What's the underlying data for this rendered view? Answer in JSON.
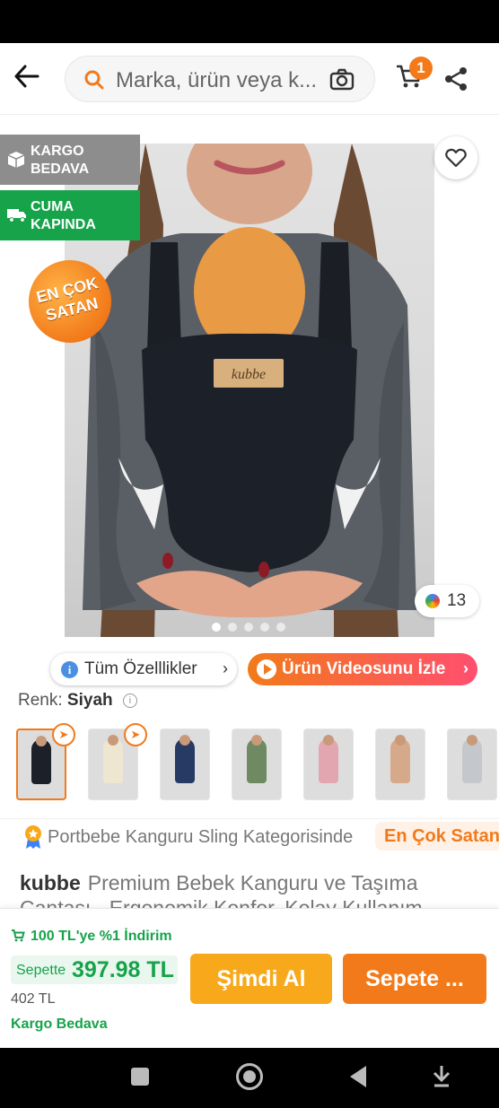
{
  "search": {
    "placeholder": "Marka, ürün veya k..."
  },
  "cart": {
    "count": "1"
  },
  "gallery": {
    "tags": [
      {
        "label": "KARGO BEDAVA"
      },
      {
        "label": "CUMA KAPINDA"
      }
    ],
    "best_seller_seal": "EN ÇOK SATAN",
    "product_logo": "kubbe",
    "color_count": "13",
    "image_count": 5,
    "active_image": 1
  },
  "features": {
    "all_features_label": "Tüm Özelllikler",
    "video_label": "Ürün Videosunu İzle"
  },
  "color": {
    "label": "Renk:",
    "value": "Siyah"
  },
  "variants": [
    {
      "name": "Siyah",
      "color": "#1c2028",
      "selected": true,
      "badge": true
    },
    {
      "name": "Krem",
      "color": "#efe6d2",
      "selected": false,
      "badge": true
    },
    {
      "name": "Lacivert",
      "color": "#263a64",
      "selected": false,
      "badge": false
    },
    {
      "name": "Yeşil",
      "color": "#6f8a63",
      "selected": false,
      "badge": false
    },
    {
      "name": "Pembe",
      "color": "#e2a6b0",
      "selected": false,
      "badge": false
    },
    {
      "name": "Bej",
      "color": "#d6a98a",
      "selected": false,
      "badge": false
    },
    {
      "name": "Gri",
      "color": "#c4c7cc",
      "selected": false,
      "badge": false
    }
  ],
  "category": {
    "text": "Portbebe Kanguru Sling Kategorisinde",
    "badge": "En Çok Satan"
  },
  "product": {
    "brand": "kubbe",
    "title": "Premium Bebek Kanguru ve Taşıma Çantası - Ergonomik Konfor, Kolay Kullanım"
  },
  "purchase": {
    "discount_text": "100 TL'ye %1 İndirim",
    "basket_label": "Sepette",
    "basket_price": "397.98 TL",
    "old_price": "402 TL",
    "shipping": "Kargo Bedava",
    "buy_now": "Şimdi Al",
    "add_to_cart": "Sepete ..."
  },
  "colors": {
    "accent": "#f27a1a",
    "green": "#16a34a",
    "buy_now": "#f7a81b"
  }
}
